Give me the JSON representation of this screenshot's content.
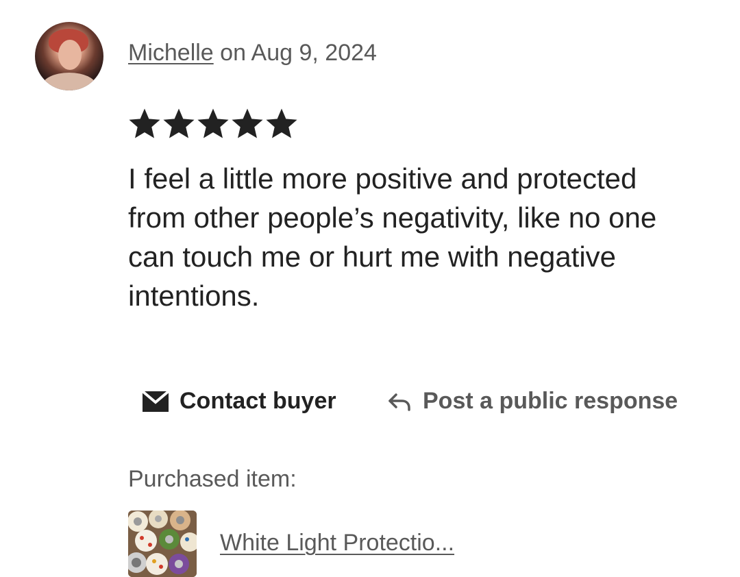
{
  "review": {
    "reviewer_name": "Michelle",
    "date_text": " on Aug 9, 2024",
    "rating": 5,
    "rating_max": 5,
    "text": "I feel a little more positive and protected from other people’s negativity, like no one can touch me or hurt me with negative intentions."
  },
  "actions": {
    "contact_label": "Contact buyer",
    "contact_icon": "envelope-icon",
    "respond_label": "Post a public response",
    "respond_icon": "reply-arrow-icon"
  },
  "purchased": {
    "label": "Purchased item:",
    "item_title": "White Light Protectio..."
  },
  "colors": {
    "text_primary": "#222222",
    "text_secondary": "#595959",
    "star": "#222222"
  }
}
